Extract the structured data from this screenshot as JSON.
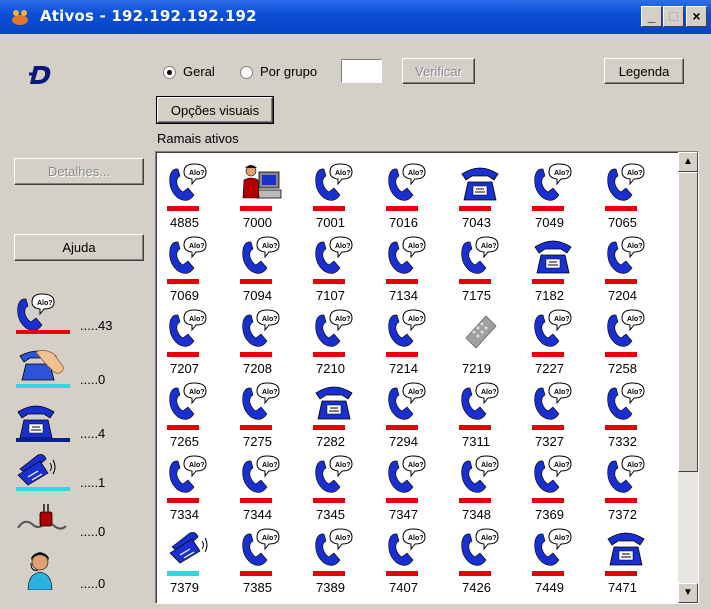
{
  "window": {
    "title": "Ativos - 192.192.192.192",
    "minimize": "_",
    "maximize": "□",
    "close": "×"
  },
  "toolbar": {
    "radio_geral": "Geral",
    "radio_por_grupo": "Por grupo",
    "group_input_value": "",
    "verificar_label": "Verificar",
    "legenda_label": "Legenda",
    "opcoes_visuais_label": "Opções visuais",
    "ramais_ativos_label": "Ramais ativos"
  },
  "sidebar": {
    "detalhes_label": "Detalhes...",
    "ajuda_label": "Ajuda",
    "legend": [
      {
        "icon": "phone-ringing-icon",
        "bar_color": "#e8000b",
        "count": ".....43"
      },
      {
        "icon": "hand-on-phone-icon",
        "bar_color": "#33d6e0",
        "count": ".....0"
      },
      {
        "icon": "desk-phone-icon",
        "bar_color": "#0b1f8c",
        "count": ".....4"
      },
      {
        "icon": "phone-talking-icon",
        "bar_color": "#33d6e0",
        "count": ".....1"
      },
      {
        "icon": "plug-disconnected-icon",
        "bar_color": "",
        "count": ".....0"
      },
      {
        "icon": "attendant-headset-icon",
        "bar_color": "",
        "count": ".....0"
      }
    ]
  },
  "extensions": [
    {
      "number": "4885",
      "icon": "phone-ringing-icon",
      "bar_color": "#e8000b"
    },
    {
      "number": "7000",
      "icon": "operator-computer-icon",
      "bar_color": "#e8000b"
    },
    {
      "number": "7001",
      "icon": "phone-ringing-icon",
      "bar_color": "#e8000b"
    },
    {
      "number": "7016",
      "icon": "phone-ringing-icon",
      "bar_color": "#e8000b"
    },
    {
      "number": "7043",
      "icon": "desk-phone-icon",
      "bar_color": "#e8000b"
    },
    {
      "number": "7049",
      "icon": "phone-ringing-icon",
      "bar_color": "#e8000b"
    },
    {
      "number": "7065",
      "icon": "phone-ringing-icon",
      "bar_color": "#e8000b"
    },
    {
      "number": "7069",
      "icon": "phone-ringing-icon",
      "bar_color": "#e8000b"
    },
    {
      "number": "7094",
      "icon": "phone-ringing-icon",
      "bar_color": "#e8000b"
    },
    {
      "number": "7107",
      "icon": "phone-ringing-icon",
      "bar_color": "#e8000b"
    },
    {
      "number": "7134",
      "icon": "phone-ringing-icon",
      "bar_color": "#e8000b"
    },
    {
      "number": "7175",
      "icon": "phone-ringing-icon",
      "bar_color": "#e8000b"
    },
    {
      "number": "7182",
      "icon": "desk-phone-icon",
      "bar_color": "#e8000b"
    },
    {
      "number": "7204",
      "icon": "phone-ringing-icon",
      "bar_color": "#e8000b"
    },
    {
      "number": "7207",
      "icon": "phone-ringing-icon",
      "bar_color": "#e8000b"
    },
    {
      "number": "7208",
      "icon": "phone-ringing-icon",
      "bar_color": "#e8000b"
    },
    {
      "number": "7210",
      "icon": "phone-ringing-icon",
      "bar_color": "#e8000b"
    },
    {
      "number": "7214",
      "icon": "phone-ringing-icon",
      "bar_color": "#e8000b"
    },
    {
      "number": "7219",
      "icon": "keypad-phone-icon",
      "bar_color": ""
    },
    {
      "number": "7227",
      "icon": "phone-ringing-icon",
      "bar_color": "#e8000b"
    },
    {
      "number": "7258",
      "icon": "phone-ringing-icon",
      "bar_color": "#e8000b"
    },
    {
      "number": "7265",
      "icon": "phone-ringing-icon",
      "bar_color": "#e8000b"
    },
    {
      "number": "7275",
      "icon": "phone-ringing-icon",
      "bar_color": "#e8000b"
    },
    {
      "number": "7282",
      "icon": "desk-phone-icon",
      "bar_color": "#e8000b"
    },
    {
      "number": "7294",
      "icon": "phone-ringing-icon",
      "bar_color": "#e8000b"
    },
    {
      "number": "7311",
      "icon": "phone-ringing-icon",
      "bar_color": "#e8000b"
    },
    {
      "number": "7327",
      "icon": "phone-ringing-icon",
      "bar_color": "#e8000b"
    },
    {
      "number": "7332",
      "icon": "phone-ringing-icon",
      "bar_color": "#e8000b"
    },
    {
      "number": "7334",
      "icon": "phone-ringing-icon",
      "bar_color": "#e8000b"
    },
    {
      "number": "7344",
      "icon": "phone-ringing-icon",
      "bar_color": "#e8000b"
    },
    {
      "number": "7345",
      "icon": "phone-ringing-icon",
      "bar_color": "#e8000b"
    },
    {
      "number": "7347",
      "icon": "phone-ringing-icon",
      "bar_color": "#e8000b"
    },
    {
      "number": "7348",
      "icon": "phone-ringing-icon",
      "bar_color": "#e8000b"
    },
    {
      "number": "7369",
      "icon": "phone-ringing-icon",
      "bar_color": "#e8000b"
    },
    {
      "number": "7372",
      "icon": "phone-ringing-icon",
      "bar_color": "#e8000b"
    },
    {
      "number": "7379",
      "icon": "phone-talking-icon",
      "bar_color": "#33d6e0"
    },
    {
      "number": "7385",
      "icon": "phone-ringing-icon",
      "bar_color": "#e8000b"
    },
    {
      "number": "7389",
      "icon": "phone-ringing-icon",
      "bar_color": "#e8000b"
    },
    {
      "number": "7407",
      "icon": "phone-ringing-icon",
      "bar_color": "#e8000b"
    },
    {
      "number": "7426",
      "icon": "phone-ringing-icon",
      "bar_color": "#e8000b"
    },
    {
      "number": "7449",
      "icon": "phone-ringing-icon",
      "bar_color": "#e8000b"
    },
    {
      "number": "7471",
      "icon": "desk-phone-icon",
      "bar_color": "#e8000b"
    }
  ]
}
